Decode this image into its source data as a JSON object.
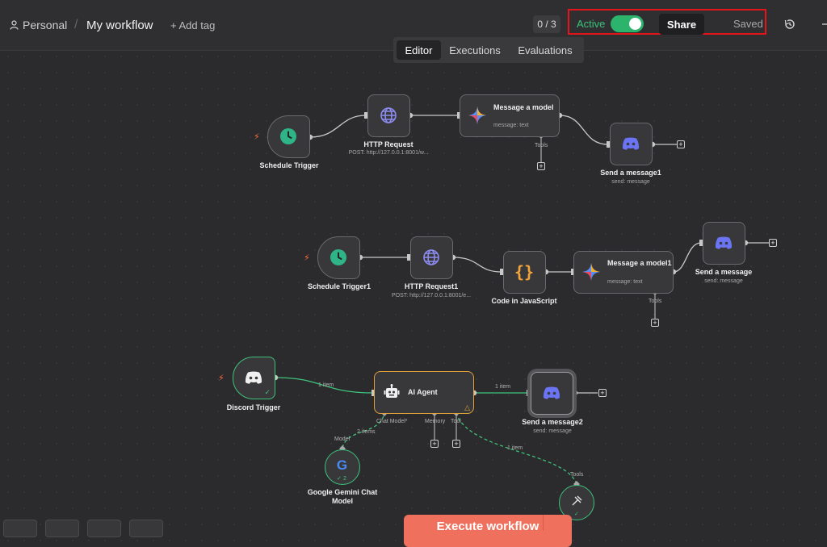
{
  "header": {
    "breadcrumb_personal": "Personal",
    "breadcrumb_sep": "/",
    "workflow_title": "My workflow",
    "add_tag": "+ Add tag",
    "counter": "0 / 3",
    "active_label": "Active",
    "active": true,
    "share_label": "Share",
    "saved_label": "Saved"
  },
  "tabs": [
    "Editor",
    "Executions",
    "Evaluations"
  ],
  "colors": {
    "accent_green": "#2cb36c",
    "execute_button": "#f0705e",
    "highlight_box": "#e3151b",
    "agent_border": "#e0a13a"
  },
  "nodes": {
    "schedule_trigger": {
      "label": "Schedule Trigger",
      "icon": "clock-icon"
    },
    "http_request": {
      "label": "HTTP Request",
      "sub": "POST: http://127.0.0.1:8001/w...",
      "icon": "globe-icon"
    },
    "message_model": {
      "label": "Message a model",
      "sub": "message: text",
      "icon": "gemini-icon",
      "port": "Tools"
    },
    "send_message1": {
      "label": "Send a message1",
      "sub": "send: message",
      "icon": "discord-icon"
    },
    "schedule_trigger1": {
      "label": "Schedule Trigger1",
      "icon": "clock-icon"
    },
    "http_request1": {
      "label": "HTTP Request1",
      "sub": "POST: http://127.0.0.1:8001/e...",
      "icon": "globe-icon"
    },
    "code_js": {
      "label": "Code in JavaScript",
      "icon": "code-braces-icon"
    },
    "message_model1": {
      "label": "Message a model1",
      "sub": "message: text",
      "icon": "gemini-icon",
      "port": "Tools"
    },
    "send_message": {
      "label": "Send a message",
      "sub": "send: message",
      "icon": "discord-icon"
    },
    "discord_trigger": {
      "label": "Discord Trigger",
      "icon": "discord-icon"
    },
    "ai_agent": {
      "label": "AI Agent",
      "icon": "robot-icon",
      "ports": [
        "Chat Model*",
        "Memory",
        "Tool"
      ]
    },
    "send_message2": {
      "label": "Send a message2",
      "sub": "send: message",
      "icon": "discord-icon"
    },
    "gemini_chat": {
      "label": "Google Gemini Chat Model",
      "icon": "google-icon",
      "port": "Model",
      "badge": "2"
    },
    "tool_node": {
      "label": "",
      "icon": "tool-icon",
      "port": "Tools"
    }
  },
  "edges": {
    "discord_to_agent": "1 item",
    "agent_to_send": "1 item",
    "gemini_to_agent": "2 items",
    "tool_to_agent": "1 item"
  },
  "execute_button": "Execute workflow"
}
